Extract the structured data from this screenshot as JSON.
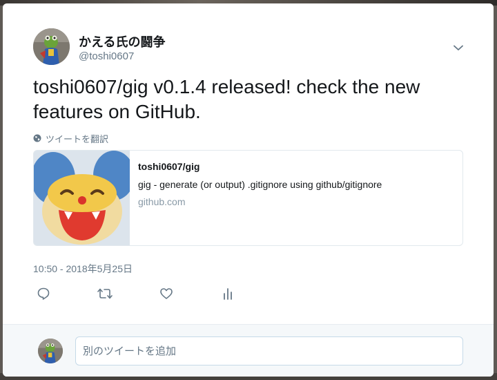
{
  "tweet": {
    "author": {
      "display_name": "かえる氏の闘争",
      "handle": "@toshi0607",
      "avatar_icon": "frog-figure-avatar"
    },
    "menu_icon": "chevron-down-icon",
    "text": "toshi0607/gig v0.1.4 released! check the new features on GitHub.",
    "translate": {
      "icon": "globe-icon",
      "label": "ツイートを翻訳"
    },
    "card": {
      "image_icon": "mouse-mascot-icon",
      "title": "toshi0607/gig",
      "description": "gig - generate (or output) .gitignore using github/gitignore",
      "domain": "github.com"
    },
    "timestamp": "10:50 - 2018年5月25日",
    "actions": [
      {
        "name": "reply",
        "icon": "reply-icon"
      },
      {
        "name": "retweet",
        "icon": "retweet-icon"
      },
      {
        "name": "like",
        "icon": "heart-icon"
      },
      {
        "name": "analytics",
        "icon": "analytics-icon"
      }
    ]
  },
  "reply_box": {
    "placeholder": "別のツイートを追加",
    "value": ""
  },
  "colors": {
    "text_primary": "#14171a",
    "text_secondary": "#657786",
    "border": "#e1e8ed",
    "reply_bg": "#f5f8fa"
  }
}
